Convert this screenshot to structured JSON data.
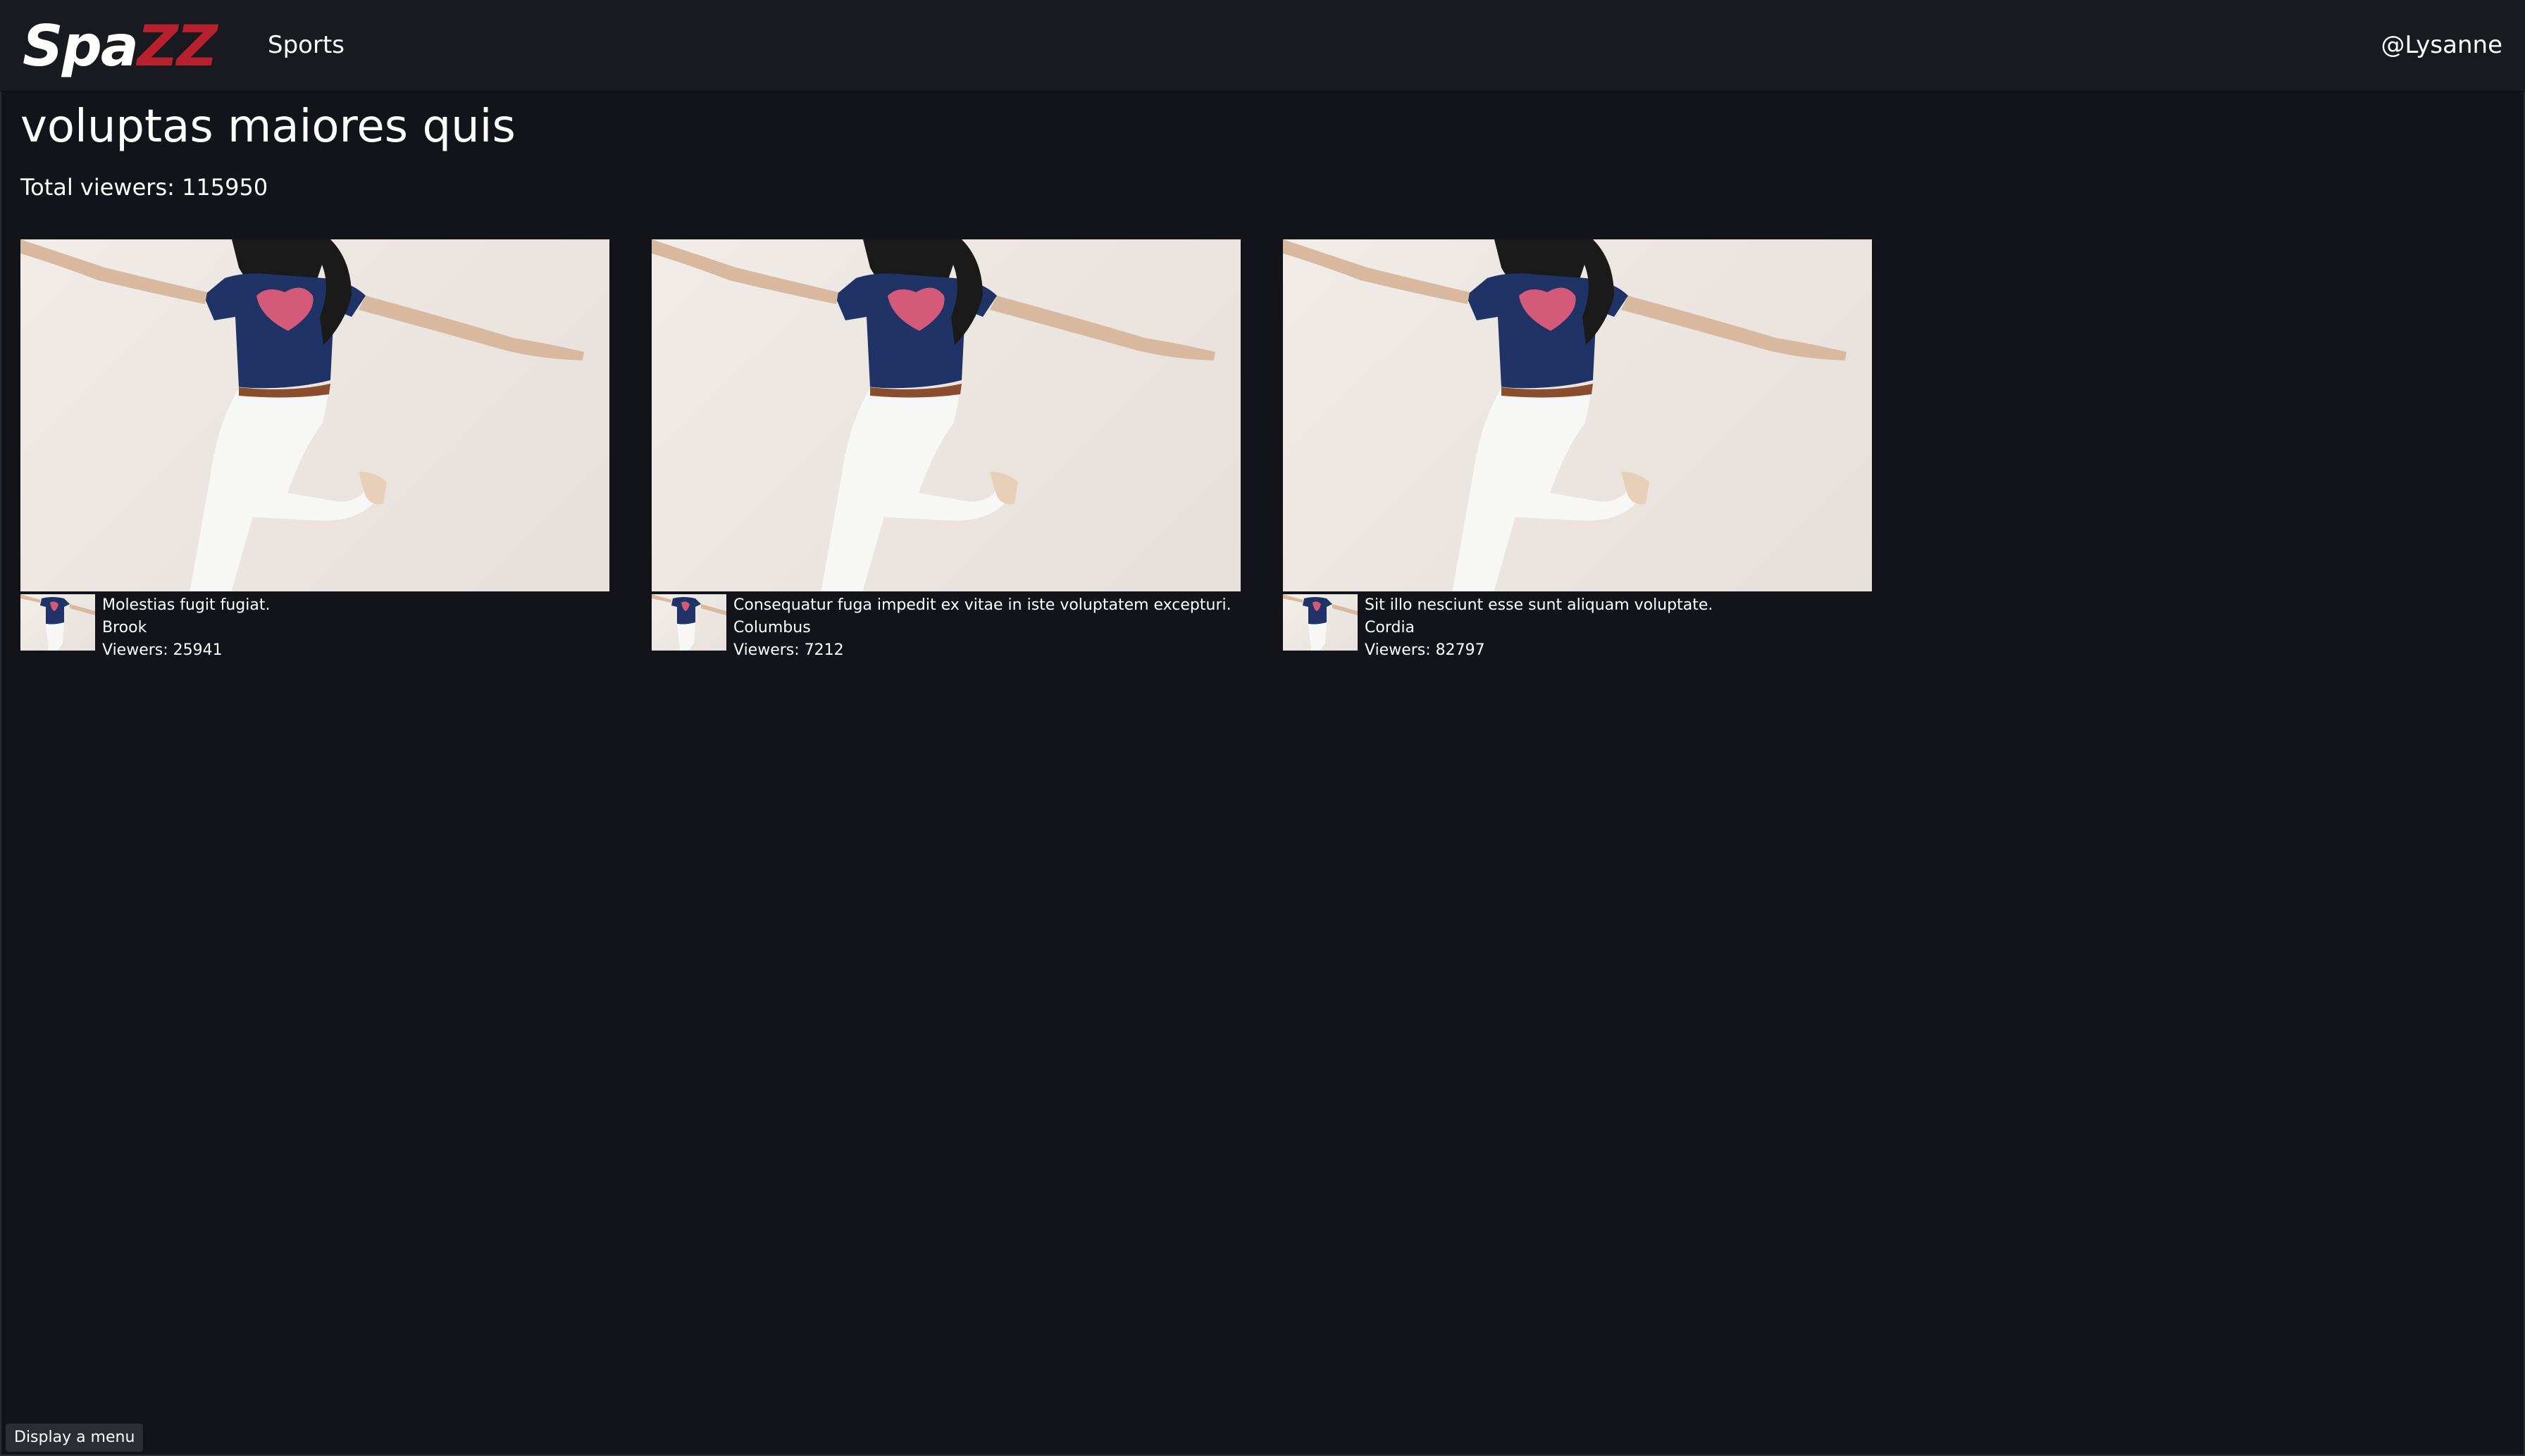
{
  "header": {
    "logo_part1": "Spa",
    "logo_part2": "ZZ",
    "nav_sports": "Sports",
    "user_handle": "@Lysanne"
  },
  "main": {
    "title": "voluptas maiores quis",
    "total_viewers_label": "Total viewers:",
    "total_viewers_value": "115950"
  },
  "streams": [
    {
      "title": "Molestias fugit fugiat.",
      "streamer": "Brook",
      "viewers_label": "Viewers:",
      "viewers": "25941"
    },
    {
      "title": "Consequatur fuga impedit ex vitae in iste voluptatem excepturi.",
      "streamer": "Columbus",
      "viewers_label": "Viewers:",
      "viewers": "7212"
    },
    {
      "title": "Sit illo nesciunt esse sunt aliquam voluptate.",
      "streamer": "Cordia",
      "viewers_label": "Viewers:",
      "viewers": "82797"
    }
  ],
  "footer": {
    "menu_button": "Display a menu"
  },
  "colors": {
    "background": "#13141a",
    "header": "#181a20",
    "logo_accent": "#b8202d",
    "text": "#ffffff"
  }
}
